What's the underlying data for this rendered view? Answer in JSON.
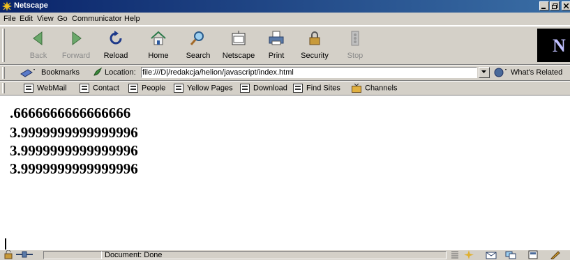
{
  "window": {
    "title": "Netscape"
  },
  "menu": [
    "File",
    "Edit",
    "View",
    "Go",
    "Communicator",
    "Help"
  ],
  "toolbar": {
    "buttons": [
      {
        "label": "Back",
        "icon": "back-arrow-icon",
        "enabled": false
      },
      {
        "label": "Forward",
        "icon": "forward-arrow-icon",
        "enabled": false
      },
      {
        "label": "Reload",
        "icon": "reload-icon",
        "enabled": true
      },
      {
        "label": "Home",
        "icon": "home-icon",
        "enabled": true
      },
      {
        "label": "Search",
        "icon": "search-icon",
        "enabled": true
      },
      {
        "label": "Netscape",
        "icon": "netscape-icon",
        "enabled": true
      },
      {
        "label": "Print",
        "icon": "print-icon",
        "enabled": true
      },
      {
        "label": "Security",
        "icon": "lock-icon",
        "enabled": true
      },
      {
        "label": "Stop",
        "icon": "stop-icon",
        "enabled": false
      }
    ],
    "logo_letter": "N"
  },
  "location": {
    "bookmarks_label": "Bookmarks",
    "location_label": "Location:",
    "url": "file:///D|/redakcja/helion/javascript/index.html",
    "whats_related_label": "What's Related"
  },
  "personal_toolbar": [
    "WebMail",
    "Contact",
    "People",
    "Yellow Pages",
    "Download",
    "Find Sites",
    "Channels"
  ],
  "content": {
    "lines": [
      ".6666666666666666",
      "3.9999999999999996",
      "3.9999999999999996",
      "3.9999999999999996"
    ]
  },
  "status": {
    "text": "Document: Done"
  },
  "colors": {
    "chrome": "#d4d0c8",
    "titlebar_start": "#0a246a",
    "titlebar_end": "#3a6ea5"
  }
}
